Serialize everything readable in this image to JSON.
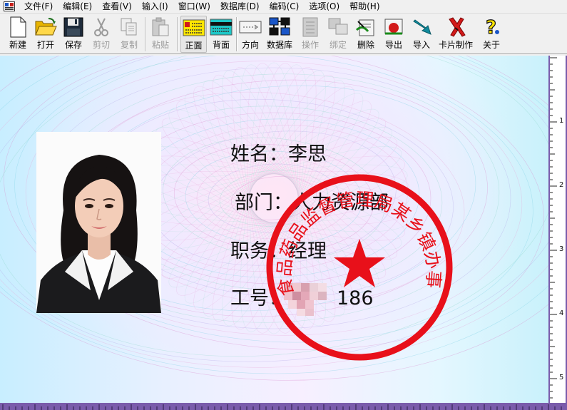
{
  "menu": {
    "items": [
      "文件(F)",
      "编辑(E)",
      "查看(V)",
      "输入(I)",
      "窗口(W)",
      "数据库(D)",
      "编码(C)",
      "选项(O)",
      "帮助(H)"
    ]
  },
  "toolbar": {
    "new": "新建",
    "open": "打开",
    "save": "保存",
    "cut": "剪切",
    "copy": "复制",
    "paste": "粘贴",
    "front": "正面",
    "back": "背面",
    "direction": "方向",
    "database": "数据库",
    "operate": "操作",
    "bind": "绑定",
    "delete": "删除",
    "export": "导出",
    "import": "导入",
    "card_make": "卡片制作",
    "about": "关于"
  },
  "card": {
    "name_line": "姓名：李思",
    "dept_line": "部门：人力资源部",
    "title_line": "职务：经理",
    "id_label": "工号：",
    "id_suffix": "186",
    "seal_text": "食品药品监督管理局某乡镇办事处"
  },
  "ruler": {
    "vertical_labels": [
      "1",
      "2",
      "3",
      "4",
      "5"
    ]
  },
  "colors": {
    "seal_red": "#e8101a",
    "ruler_purple": "#7a5cab"
  }
}
